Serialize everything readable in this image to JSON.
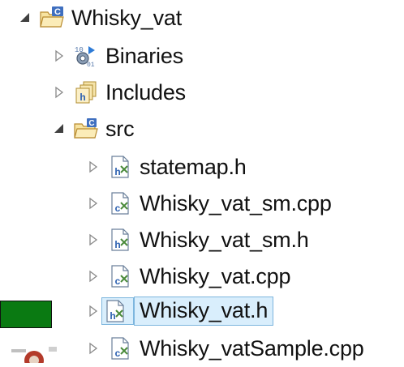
{
  "tree": {
    "project": {
      "label": "Whisky_vat",
      "icon": "c-project-folder-icon",
      "expanded": true
    },
    "items": [
      {
        "label": "Binaries",
        "icon": "binaries-icon",
        "expanded": false,
        "level": 1
      },
      {
        "label": "Includes",
        "icon": "includes-icon",
        "expanded": false,
        "level": 1
      },
      {
        "label": "src",
        "icon": "source-folder-icon",
        "expanded": true,
        "level": 1
      }
    ],
    "files": [
      {
        "label": "statemap.h",
        "icon": "header-file-icon",
        "type": "h"
      },
      {
        "label": "Whisky_vat_sm.cpp",
        "icon": "cpp-file-icon",
        "type": "cpp"
      },
      {
        "label": "Whisky_vat_sm.h",
        "icon": "header-file-icon",
        "type": "h"
      },
      {
        "label": "Whisky_vat.cpp",
        "icon": "cpp-file-icon",
        "type": "cpp"
      },
      {
        "label": "Whisky_vat.h",
        "icon": "header-file-icon",
        "type": "h",
        "selected": true
      },
      {
        "label": "Whisky_vatSample.cpp",
        "icon": "cpp-file-icon",
        "type": "cpp"
      }
    ]
  },
  "colors": {
    "selection_bg": "#d9eefc",
    "selection_border": "#7db6de",
    "green_block": "#0a7a12"
  }
}
